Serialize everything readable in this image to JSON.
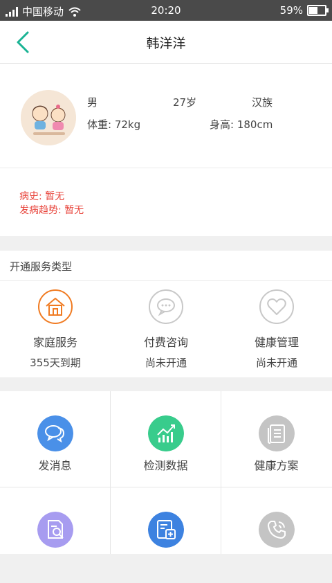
{
  "status_bar": {
    "carrier": "中国移动",
    "time": "20:20",
    "battery": "59%",
    "battery_level": 0.59
  },
  "header": {
    "title": "韩洋洋",
    "back_icon": "chevron-left-icon"
  },
  "profile": {
    "gender": "男",
    "age": "27岁",
    "ethnicity": "汉族",
    "weight": "体重: 72kg",
    "height": "身高: 180cm",
    "history": "病史: 暂无",
    "trend": "发病趋势: 暂无"
  },
  "services": {
    "title": "开通服务类型",
    "items": [
      {
        "name": "家庭服务",
        "status": "355天到期",
        "icon": "home-icon",
        "color": "#f07b22"
      },
      {
        "name": "付费咨询",
        "status": "尚未开通",
        "icon": "chat-icon",
        "color": "#c8c8c8"
      },
      {
        "name": "健康管理",
        "status": "尚未开通",
        "icon": "heart-icon",
        "color": "#c8c8c8"
      }
    ]
  },
  "actions": [
    {
      "label": "发消息",
      "icon": "message-icon",
      "color": "#4a90e8"
    },
    {
      "label": "检测数据",
      "icon": "chart-icon",
      "color": "#38cc8c"
    },
    {
      "label": "健康方案",
      "icon": "document-icon",
      "color": "#c4c4c4"
    },
    {
      "label": "",
      "icon": "search-document-icon",
      "color": "#a79cf0"
    },
    {
      "label": "",
      "icon": "medical-record-icon",
      "color": "#3d82e0"
    },
    {
      "label": "",
      "icon": "phone-icon",
      "color": "#c4c4c4"
    }
  ]
}
